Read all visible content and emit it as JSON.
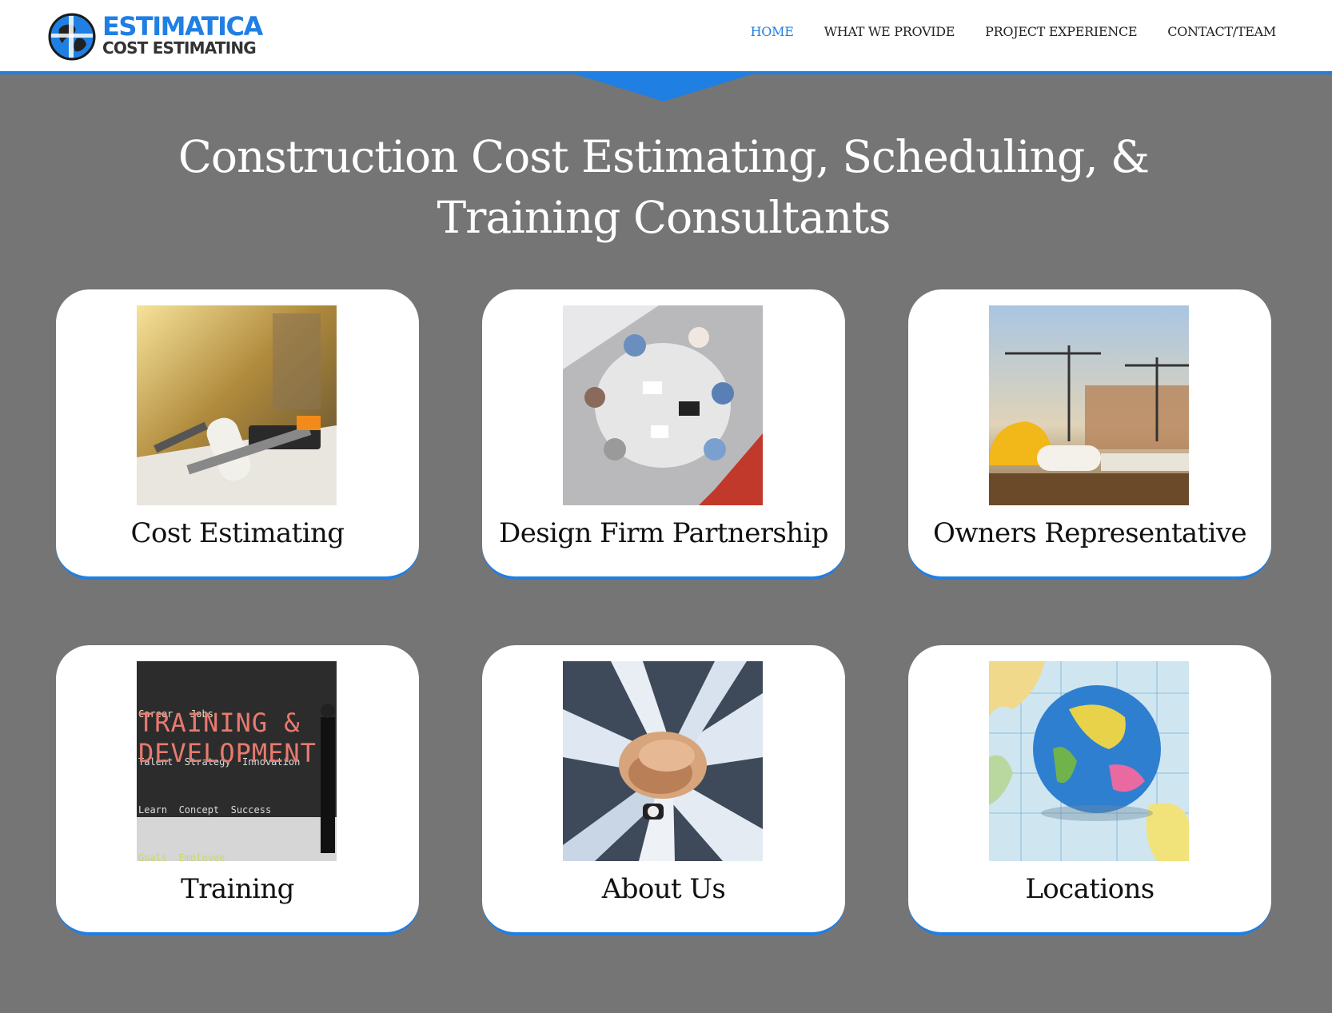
{
  "brand": {
    "name_line1": "ESTIMATICA",
    "name_line2": "COST ESTIMATING",
    "primary_color": "#1f7fe3"
  },
  "nav": {
    "items": [
      {
        "label": "HOME",
        "active": true
      },
      {
        "label": "WHAT WE PROVIDE",
        "active": false
      },
      {
        "label": "PROJECT EXPERIENCE",
        "active": false
      },
      {
        "label": "CONTACT/TEAM",
        "active": false
      }
    ]
  },
  "hero": {
    "title": "Construction Cost Estimating, Scheduling, & Training Consultants"
  },
  "cards": [
    {
      "label": "Cost Estimating",
      "image": "construction-tools-blueprints-photo"
    },
    {
      "label": "Design Firm Partnership",
      "image": "team-meeting-table-photo"
    },
    {
      "label": "Owners Representative",
      "image": "hardhat-cranes-skyline-photo"
    },
    {
      "label": "Training",
      "image": "training-development-chalkboard-photo",
      "image_text": {
        "line1": "Career   Jobs",
        "line2": "Talent  Strategy  Innovation",
        "line3": "TRAINING &",
        "line4": "DEVELOPMENT",
        "line5": "Learn  Concept  Success",
        "line6": "Goals  Employee"
      }
    },
    {
      "label": "About Us",
      "image": "stacked-hands-teamwork-photo"
    },
    {
      "label": "Locations",
      "image": "globe-on-map-photo"
    }
  ],
  "colors": {
    "page_background": "#757575",
    "card_background": "#ffffff",
    "accent": "#1f7fe3"
  }
}
